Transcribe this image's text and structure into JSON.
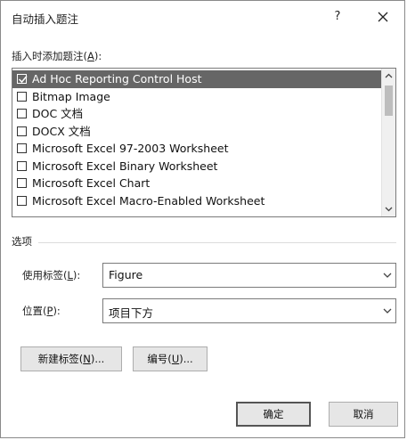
{
  "window": {
    "title": "自动插入题注",
    "help_glyph": "?",
    "close_icon": "close-icon"
  },
  "caption_list": {
    "label_prefix": "插入时添加题注(",
    "label_access": "A",
    "label_suffix": "):",
    "items": [
      {
        "label": "Ad Hoc Reporting Control Host",
        "checked": true,
        "selected": true
      },
      {
        "label": "Bitmap Image",
        "checked": false,
        "selected": false
      },
      {
        "label": "DOC 文档",
        "checked": false,
        "selected": false
      },
      {
        "label": "DOCX 文档",
        "checked": false,
        "selected": false
      },
      {
        "label": "Microsoft Excel 97-2003 Worksheet",
        "checked": false,
        "selected": false
      },
      {
        "label": "Microsoft Excel Binary Worksheet",
        "checked": false,
        "selected": false
      },
      {
        "label": "Microsoft Excel Chart",
        "checked": false,
        "selected": false
      },
      {
        "label": "Microsoft Excel Macro-Enabled Worksheet",
        "checked": false,
        "selected": false
      }
    ]
  },
  "options": {
    "group_title": "选项",
    "use_label": {
      "label_prefix": "使用标签(",
      "label_access": "L",
      "label_suffix": "):",
      "value": "Figure"
    },
    "position": {
      "label_prefix": "位置(",
      "label_access": "P",
      "label_suffix": "):",
      "value": "项目下方"
    }
  },
  "buttons": {
    "new_label": {
      "prefix": "新建标签(",
      "access": "N",
      "suffix": ")..."
    },
    "numbering": {
      "prefix": "编号(",
      "access": "U",
      "suffix": ")..."
    },
    "ok": "确定",
    "cancel": "取消"
  },
  "colors": {
    "selection": "#666666",
    "button_face": "#e6e6e6",
    "border": "#7a7a7a"
  }
}
